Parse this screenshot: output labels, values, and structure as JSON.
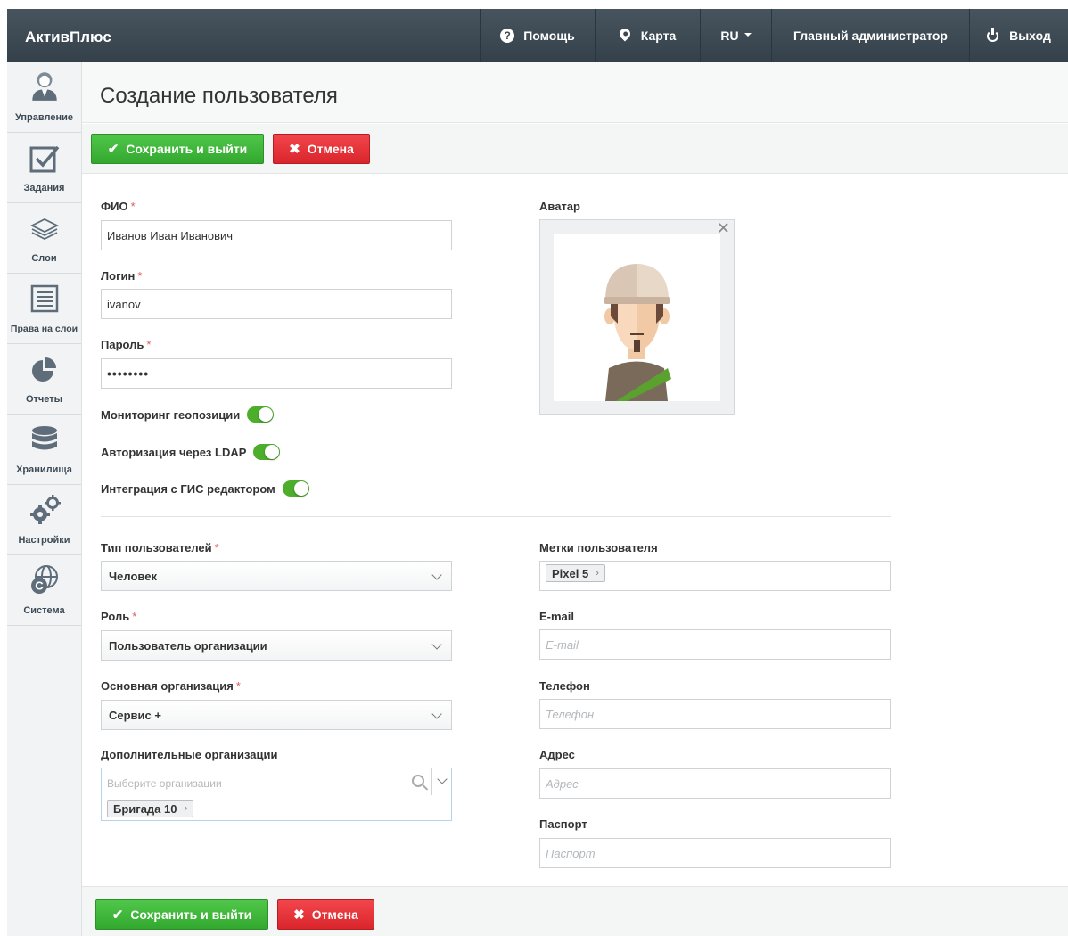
{
  "app": {
    "brand": "АктивПлюс"
  },
  "topnav": {
    "help": "Помощь",
    "map": "Карта",
    "lang": "RU",
    "user": "Главный администратор",
    "logout": "Выход"
  },
  "sidebar": {
    "items": [
      {
        "label": "Управление",
        "icon": "user-admin-icon"
      },
      {
        "label": "Задания",
        "icon": "checkbox-icon"
      },
      {
        "label": "Слои",
        "icon": "layers-icon"
      },
      {
        "label": "Права на слои",
        "icon": "document-list-icon"
      },
      {
        "label": "Отчеты",
        "icon": "pie-chart-icon"
      },
      {
        "label": "Хранилища",
        "icon": "database-icon"
      },
      {
        "label": "Настройки",
        "icon": "gears-icon"
      },
      {
        "label": "Система",
        "icon": "globe-icon"
      }
    ]
  },
  "page": {
    "title": "Создание пользователя"
  },
  "actions": {
    "save": "Сохранить и выйти",
    "cancel": "Отмена"
  },
  "form": {
    "fio_label": "ФИО",
    "fio_value": "Иванов Иван Иванович",
    "login_label": "Логин",
    "login_value": "ivanov",
    "password_label": "Пароль",
    "password_value": "••••••••",
    "avatar_label": "Аватар",
    "toggle_geo": "Мониторинг геопозиции",
    "toggle_ldap": "Авторизация через LDAP",
    "toggle_gis": "Интеграция с ГИС редактором",
    "user_type_label": "Тип пользователей",
    "user_type_value": "Человек",
    "role_label": "Роль",
    "role_value": "Пользователь организации",
    "main_org_label": "Основная организация",
    "main_org_value": "Сервис +",
    "extra_orgs_label": "Дополнительные организации",
    "extra_orgs_placeholder": "Выберите организации",
    "extra_orgs_tag": "Бригада 10",
    "tags_label": "Метки пользователя",
    "tags_value": "Pixel 5",
    "email_label": "E-mail",
    "email_placeholder": "E-mail",
    "phone_label": "Телефон",
    "phone_placeholder": "Телефон",
    "address_label": "Адрес",
    "address_placeholder": "Адрес",
    "passport_label": "Паспорт",
    "passport_placeholder": "Паспорт",
    "required_mark": "*"
  },
  "colors": {
    "topbar": "#3d4952",
    "save": "#3cb536",
    "cancel": "#e5343a",
    "toggle_on": "#4cae2b"
  }
}
